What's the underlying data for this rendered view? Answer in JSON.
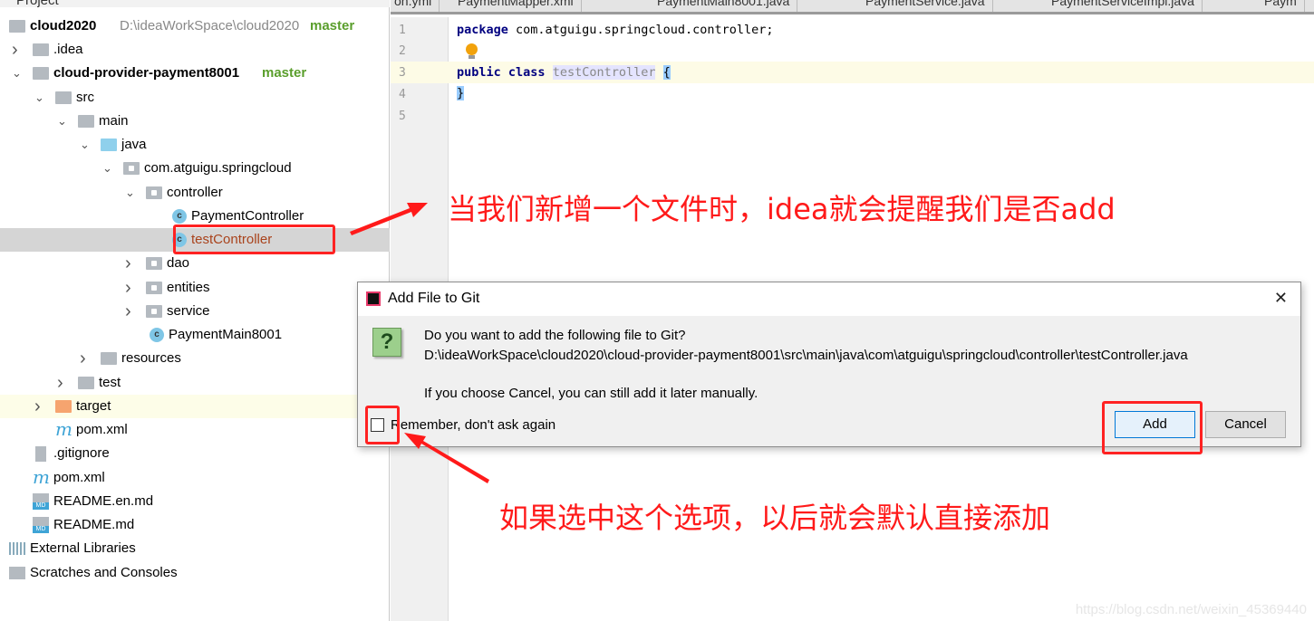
{
  "project_panel": {
    "title": "Project",
    "tree": [
      {
        "label": "cloud2020",
        "extra": "D:\\ideaWorkSpace\\cloud2020",
        "branch": "master",
        "level": 0,
        "icon": "module-folder-icon",
        "chev": ""
      },
      {
        "label": ".idea",
        "level": 1,
        "icon": "folder-icon",
        "chev": "closed"
      },
      {
        "label": "cloud-provider-payment8001",
        "branch": "master",
        "level": 1,
        "icon": "module-folder-icon",
        "chev": "open",
        "bold": true
      },
      {
        "label": "src",
        "level": 2,
        "icon": "folder-icon",
        "chev": "open"
      },
      {
        "label": "main",
        "level": 3,
        "icon": "folder-icon",
        "chev": "open"
      },
      {
        "label": "java",
        "level": 4,
        "icon": "source-folder-icon",
        "chev": "open"
      },
      {
        "label": "com.atguigu.springcloud",
        "level": 5,
        "icon": "package-icon",
        "chev": "open"
      },
      {
        "label": "controller",
        "level": 6,
        "icon": "package-icon",
        "chev": "open"
      },
      {
        "label": "PaymentController",
        "level": 7,
        "icon": "class-icon",
        "chev": ""
      },
      {
        "label": "testController",
        "level": 7,
        "icon": "class-icon",
        "chev": "",
        "selected": true,
        "untracked": true
      },
      {
        "label": "dao",
        "level": 6,
        "icon": "package-icon",
        "chev": "closed"
      },
      {
        "label": "entities",
        "level": 6,
        "icon": "package-icon",
        "chev": "closed"
      },
      {
        "label": "service",
        "level": 6,
        "icon": "package-icon",
        "chev": "closed"
      },
      {
        "label": "PaymentMain8001",
        "level": 6,
        "icon": "spring-boot-class-icon",
        "chev": ""
      },
      {
        "label": "resources",
        "level": 4,
        "icon": "resources-folder-icon",
        "chev": "closed"
      },
      {
        "label": "test",
        "level": 3,
        "icon": "folder-icon",
        "chev": "closed"
      },
      {
        "label": "target",
        "level": 2,
        "icon": "excluded-folder-icon",
        "chev": "closed",
        "highlight": true
      },
      {
        "label": "pom.xml",
        "level": 2,
        "icon": "maven-icon",
        "chev": ""
      },
      {
        "label": ".gitignore",
        "level": 1,
        "icon": "text-file-icon",
        "chev": ""
      },
      {
        "label": "pom.xml",
        "level": 1,
        "icon": "maven-icon",
        "chev": ""
      },
      {
        "label": "README.en.md",
        "level": 1,
        "icon": "markdown-icon",
        "chev": ""
      },
      {
        "label": "README.md",
        "level": 1,
        "icon": "markdown-icon",
        "chev": ""
      },
      {
        "label": "External Libraries",
        "level": 0,
        "icon": "libraries-icon",
        "chev": ""
      },
      {
        "label": "Scratches and Consoles",
        "level": 0,
        "icon": "scratches-icon",
        "chev": ""
      }
    ]
  },
  "editor": {
    "tabs": [
      "on.yml",
      "PaymentMapper.xml",
      "PaymentMain8001.java",
      "PaymentService.java",
      "PaymentServiceImpl.java",
      "Paym"
    ],
    "lines": [
      "1",
      "2",
      "3",
      "4",
      "5"
    ],
    "code": {
      "l1_kw": "package",
      "l1_rest": " com.atguigu.springcloud.controller;",
      "l3_kw": "public class",
      "l3_name": "testController",
      "l3_brace": "{",
      "l4": "}"
    }
  },
  "dialog": {
    "title": "Add File to Git",
    "question": "Do you want to add the following file to Git?",
    "path": "D:\\ideaWorkSpace\\cloud2020\\cloud-provider-payment8001\\src\\main\\java\\com\\atguigu\\springcloud\\controller\\testController.java",
    "note": "If you choose Cancel, you can still add it later manually.",
    "remember_label": "Remember, don't ask again",
    "remember_checked": false,
    "add_label": "Add",
    "cancel_label": "Cancel",
    "close_glyph": "✕",
    "question_glyph": "?"
  },
  "annotations": {
    "top": "当我们新增一个文件时，idea就会提醒我们是否add",
    "bottom": "如果选中这个选项，以后就会默认直接添加",
    "color": "#ff1a1a"
  },
  "watermark": "https://blog.csdn.net/weixin_45369440"
}
